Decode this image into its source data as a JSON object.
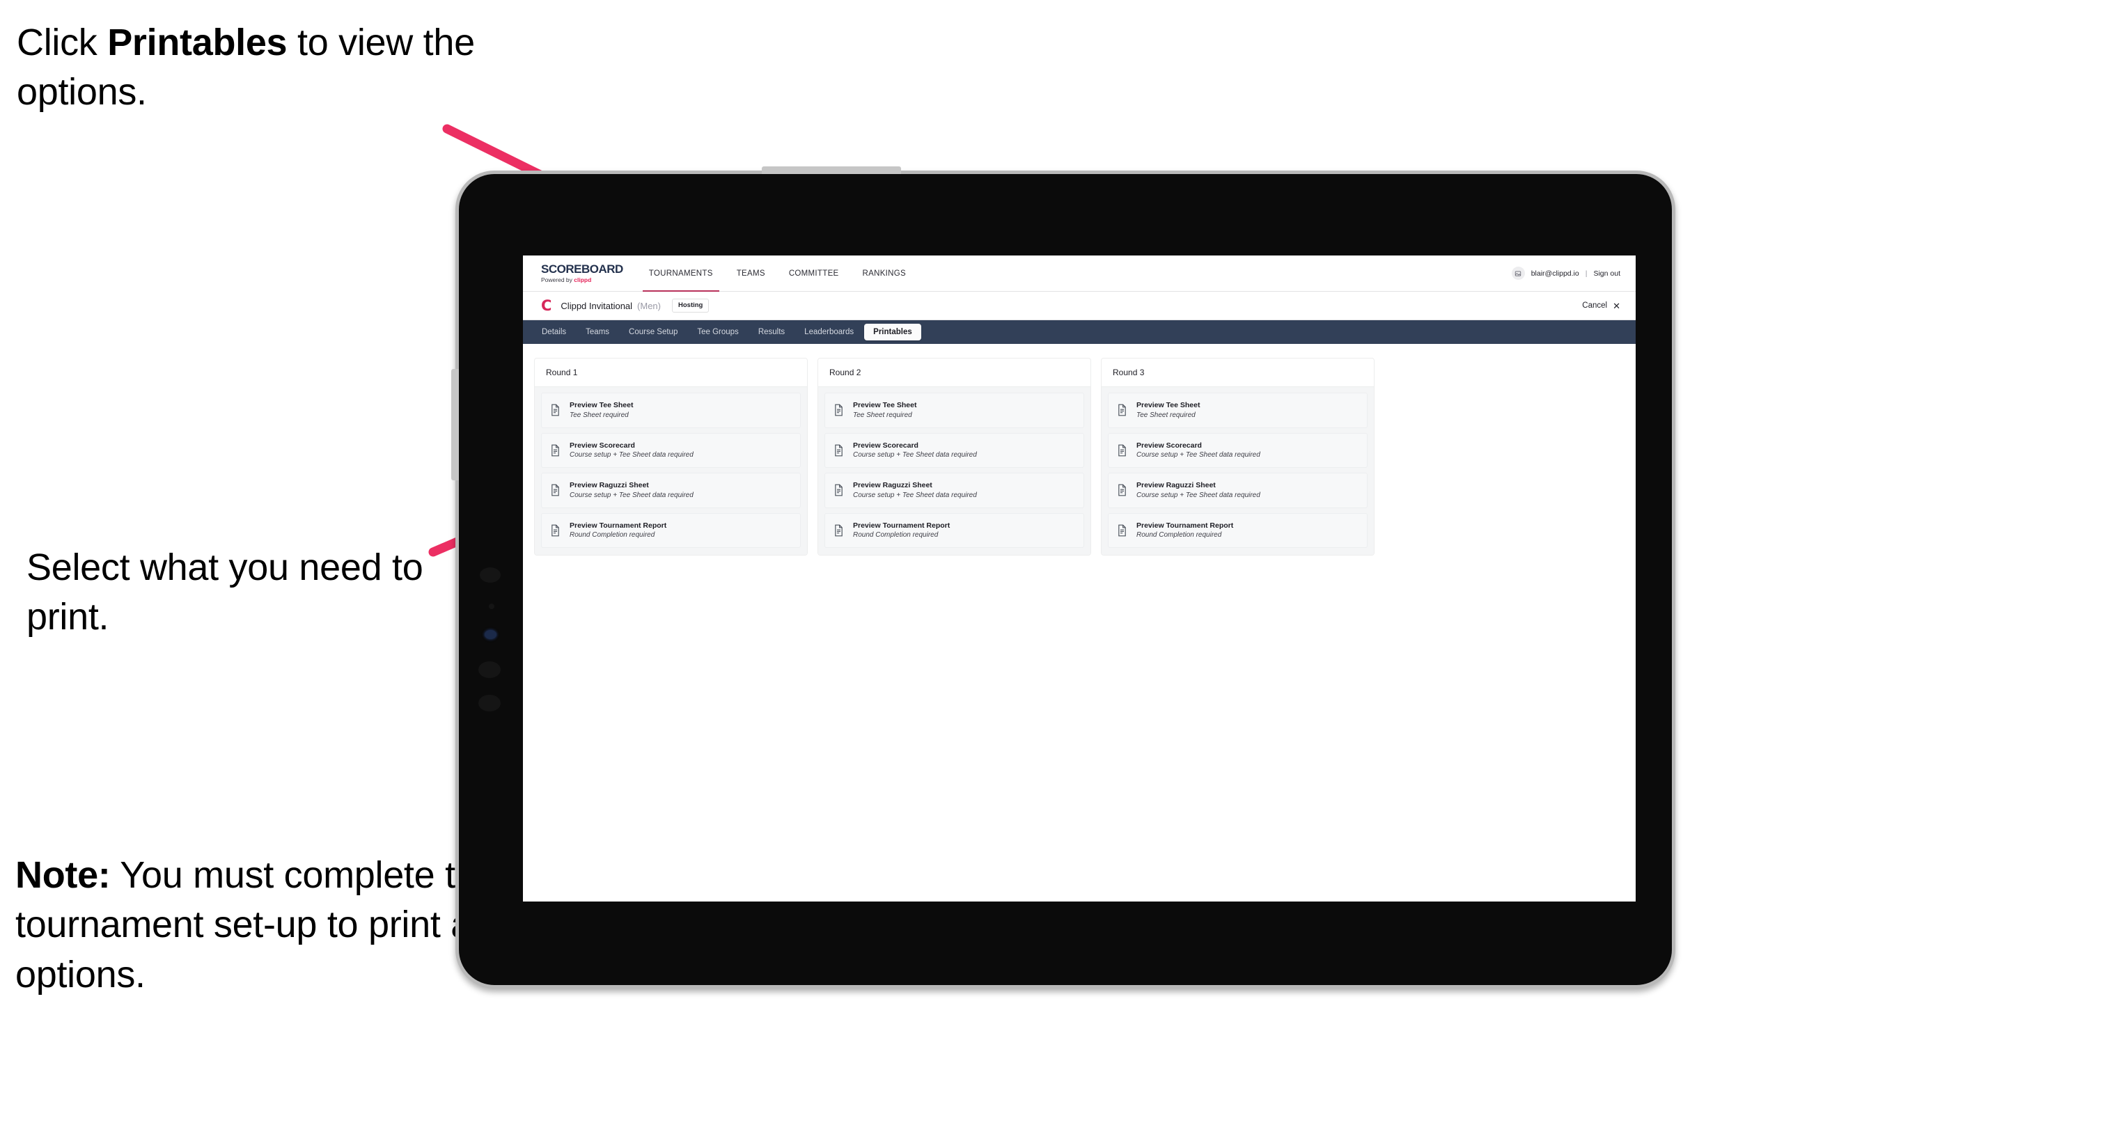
{
  "annotations": {
    "click_printables": {
      "pre": "Click ",
      "bold": "Printables",
      "post": " to view the options."
    },
    "select_print": "Select what you need to print.",
    "note": {
      "bold": "Note:",
      "text": " You must complete the tournament set-up to print all the options."
    },
    "arrow_color": "#ec2f63"
  },
  "app": {
    "brand": {
      "wordmark": "SCOREBOARD",
      "powered_by": "Powered by ",
      "powered_by_brand": "clippd"
    },
    "topnav": [
      {
        "label": "TOURNAMENTS",
        "active": true
      },
      {
        "label": "TEAMS",
        "active": false
      },
      {
        "label": "COMMITTEE",
        "active": false
      },
      {
        "label": "RANKINGS",
        "active": false
      }
    ],
    "account": {
      "avatar_icon": "user-avatar-icon",
      "email": "blair@clippd.io",
      "divider": "|",
      "sign_out": "Sign out"
    },
    "tournament": {
      "logo_letter": "C",
      "title": "Clippd Invitational",
      "gender": "(Men)",
      "status": "Hosting",
      "cancel_label": "Cancel",
      "cancel_icon": "close-icon"
    },
    "section_tabs": [
      {
        "label": "Details",
        "active": false
      },
      {
        "label": "Teams",
        "active": false
      },
      {
        "label": "Course Setup",
        "active": false
      },
      {
        "label": "Tee Groups",
        "active": false
      },
      {
        "label": "Results",
        "active": false
      },
      {
        "label": "Leaderboards",
        "active": false
      },
      {
        "label": "Printables",
        "active": true
      }
    ],
    "printables": {
      "rounds": [
        {
          "title": "Round 1",
          "items": [
            {
              "icon": "document-icon",
              "title": "Preview Tee Sheet",
              "requirement": "Tee Sheet required"
            },
            {
              "icon": "document-icon",
              "title": "Preview Scorecard",
              "requirement": "Course setup + Tee Sheet data required"
            },
            {
              "icon": "document-icon",
              "title": "Preview Raguzzi Sheet",
              "requirement": "Course setup + Tee Sheet data required"
            },
            {
              "icon": "document-icon",
              "title": "Preview Tournament Report",
              "requirement": "Round Completion required"
            }
          ]
        },
        {
          "title": "Round 2",
          "items": [
            {
              "icon": "document-icon",
              "title": "Preview Tee Sheet",
              "requirement": "Tee Sheet required"
            },
            {
              "icon": "document-icon",
              "title": "Preview Scorecard",
              "requirement": "Course setup + Tee Sheet data required"
            },
            {
              "icon": "document-icon",
              "title": "Preview Raguzzi Sheet",
              "requirement": "Course setup + Tee Sheet data required"
            },
            {
              "icon": "document-icon",
              "title": "Preview Tournament Report",
              "requirement": "Round Completion required"
            }
          ]
        },
        {
          "title": "Round 3",
          "items": [
            {
              "icon": "document-icon",
              "title": "Preview Tee Sheet",
              "requirement": "Tee Sheet required"
            },
            {
              "icon": "document-icon",
              "title": "Preview Scorecard",
              "requirement": "Course setup + Tee Sheet data required"
            },
            {
              "icon": "document-icon",
              "title": "Preview Raguzzi Sheet",
              "requirement": "Course setup + Tee Sheet data required"
            },
            {
              "icon": "document-icon",
              "title": "Preview Tournament Report",
              "requirement": "Round Completion required"
            }
          ]
        }
      ]
    }
  },
  "colors": {
    "accent_pink": "#ec2f63",
    "brand_red": "#d6285a",
    "tabbar_navy": "#324058",
    "card_bg": "#f7f8f9"
  }
}
